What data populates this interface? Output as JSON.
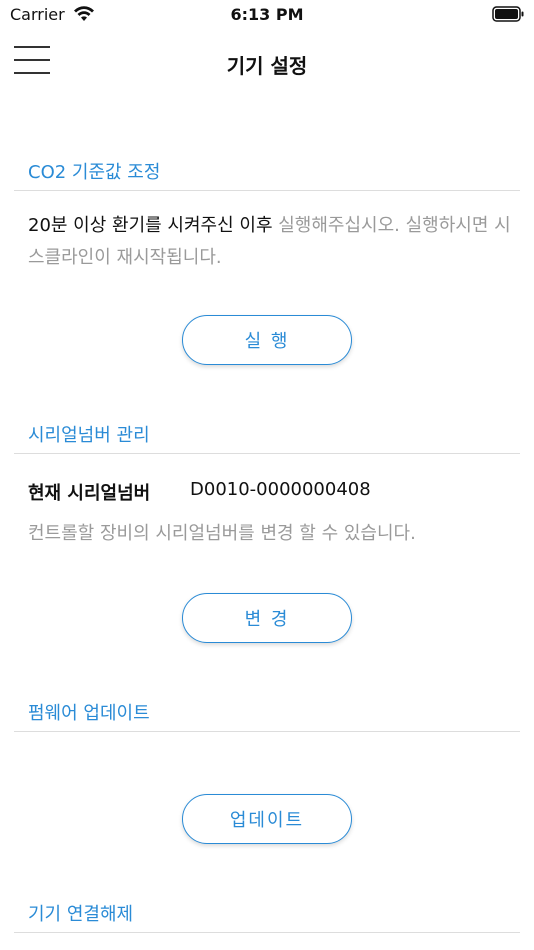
{
  "status_bar": {
    "carrier": "Carrier",
    "time": "6:13 PM"
  },
  "nav": {
    "title": "기기 설정"
  },
  "co2": {
    "header": "CO2 기준값 조정",
    "text_primary": "20분 이상 환기를 시켜주신 이후",
    "text_secondary": " 실행해주십시오. 실행하시면 시스클라인이 재시작됩니다.",
    "button_label": "실 행"
  },
  "serial": {
    "header": "시리얼넘버 관리",
    "label": "현재 시리얼넘버",
    "value": "D0010-0000000408",
    "description": "컨트롤할 장비의 시리얼넘버를 변경 할 수 있습니다.",
    "button_label": "변 경"
  },
  "firmware": {
    "header": "펌웨어 업데이트",
    "button_label": "업데이트"
  },
  "disconnect": {
    "header": "기기 연결해제"
  },
  "colors": {
    "accent": "#2a8bd6",
    "muted": "#9a9a9a",
    "divider": "#dddddd"
  }
}
